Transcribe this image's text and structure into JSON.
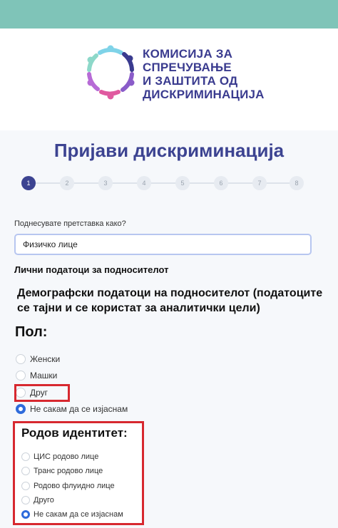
{
  "logo": {
    "lines": [
      "КОМИСИЈА ЗА",
      "СПРЕЧУВАЊЕ",
      "И ЗАШТИТА ОД",
      "ДИСКРИМИНАЦИЈА"
    ],
    "icon": "people-circle-logo"
  },
  "page_title": "Пријави дискриминација",
  "stepper": {
    "steps": [
      "1",
      "2",
      "3",
      "4",
      "5",
      "6",
      "7",
      "8"
    ],
    "active_step": 1
  },
  "form": {
    "submit_as_label": "Поднесувате претставка како?",
    "submit_as_value": "Физичко лице",
    "personal_section_title": "Лични податоци за подносителот",
    "demographic_title": "Демографски податоци на подносителот (податоците се тајни и се користат за аналитички цели)",
    "gender": {
      "heading": "Пол:",
      "options": [
        "Женски",
        "Машки",
        "Друг",
        "Не сакам да се изјаснам"
      ],
      "selected": "Не сакам да се изјаснам"
    },
    "gender_identity": {
      "heading": "Родов идентитет:",
      "options": [
        "ЦИС родово лице",
        "Транс родово лице",
        "Родово флуидно лице",
        "Друго",
        "Не сакам да се изјаснам"
      ],
      "selected": "Не сакам да се изјаснам"
    }
  },
  "colors": {
    "top_bar": "#7fc4b8",
    "brand": "#3c4391",
    "highlight": "#d7282f",
    "radio_checked": "#2e6bdb"
  }
}
